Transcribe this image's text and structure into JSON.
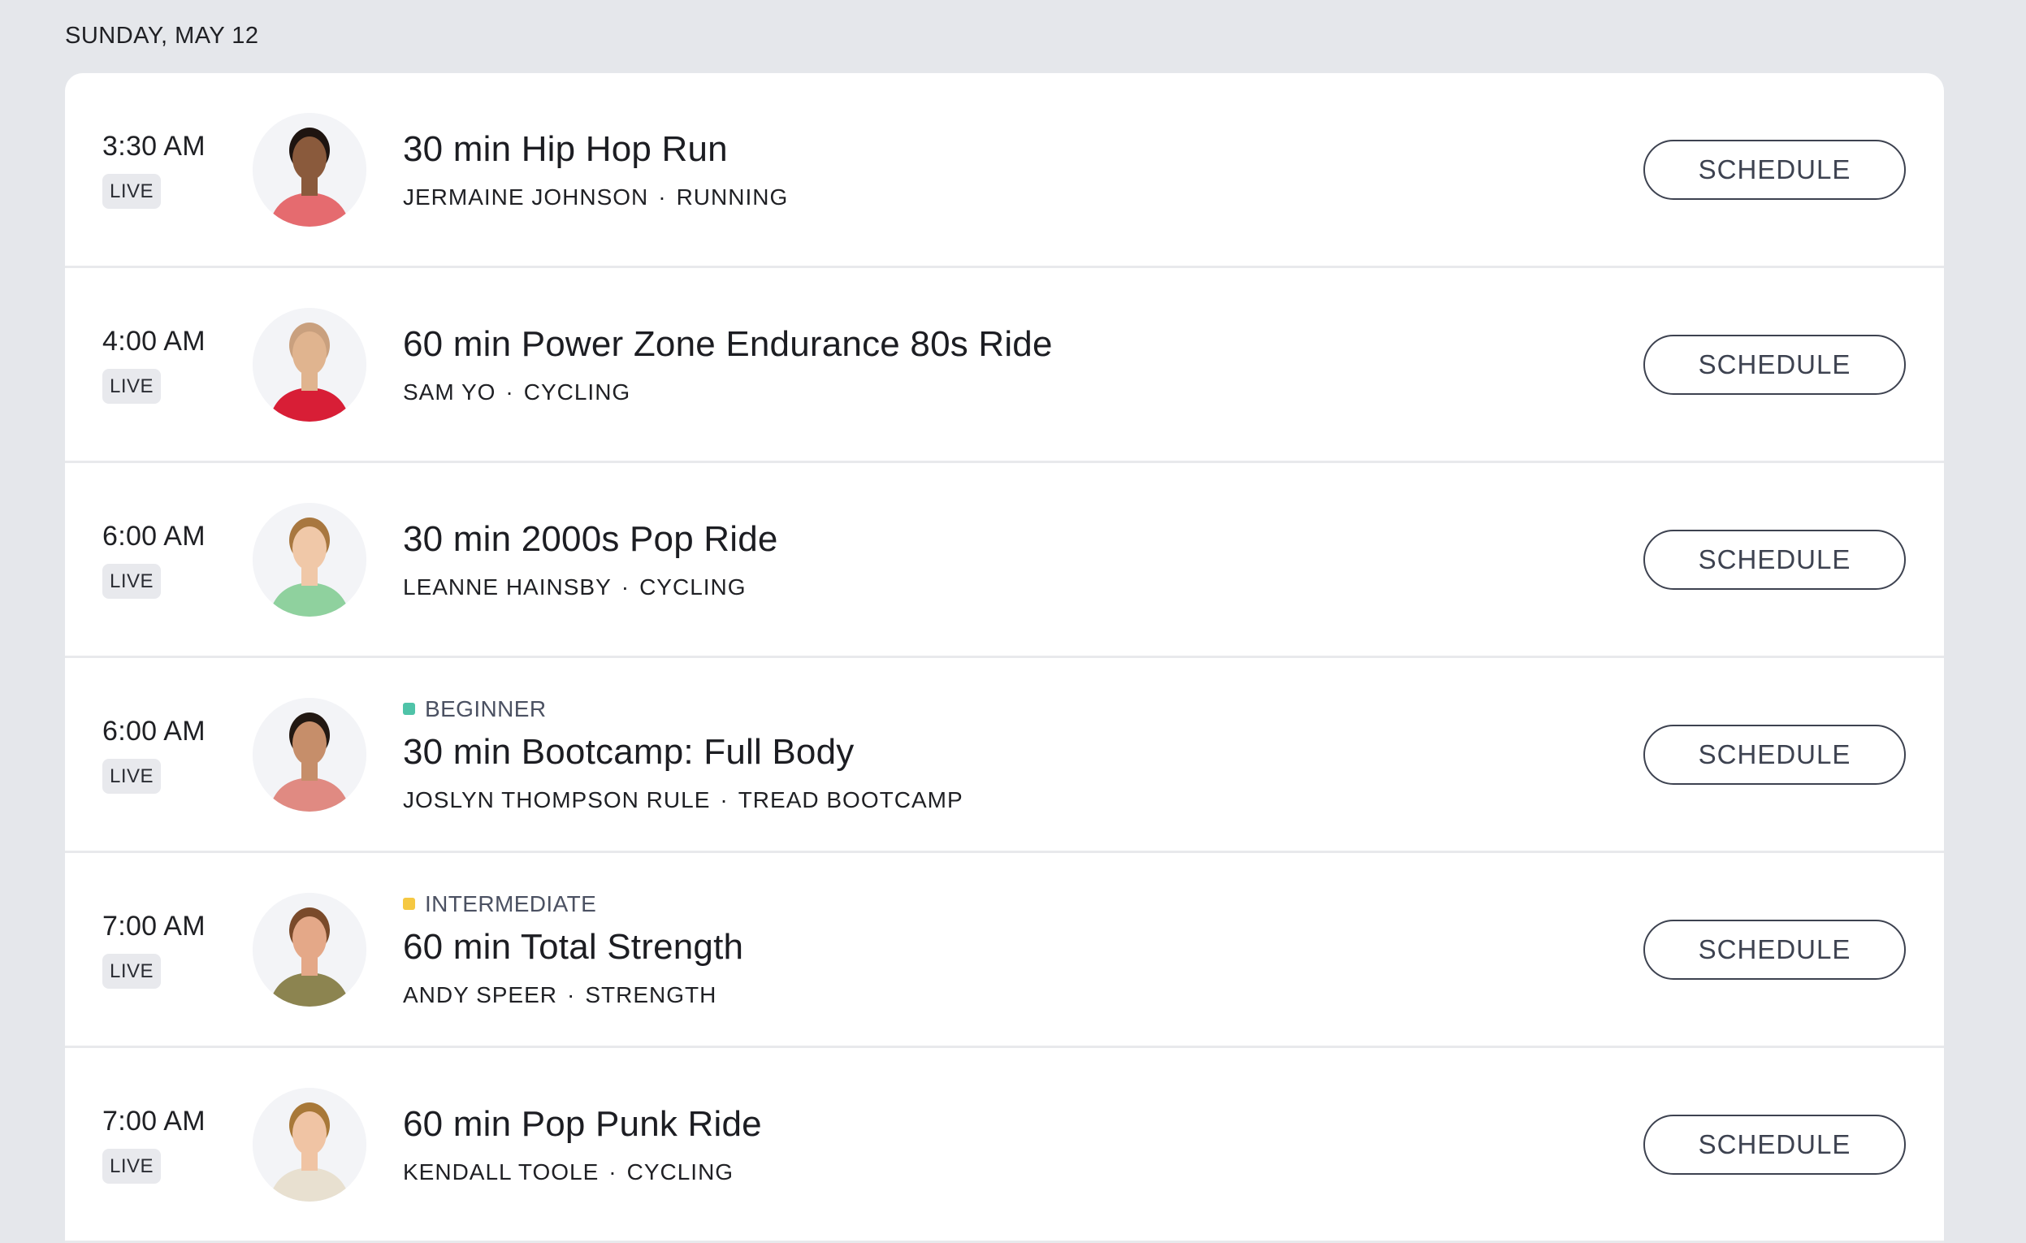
{
  "date_header": "SUNDAY, MAY 12",
  "separator": "·",
  "classes": [
    {
      "time": "3:30 AM",
      "badge": "LIVE",
      "difficulty": null,
      "title": "30 min Hip Hop Run",
      "instructor": "JERMAINE JOHNSON",
      "category": "RUNNING",
      "button": "SCHEDULE",
      "avatar": {
        "skin": "#8a5a3c",
        "hair": "#1e1410",
        "shirt": "#e56b6f"
      }
    },
    {
      "time": "4:00 AM",
      "badge": "LIVE",
      "difficulty": null,
      "title": "60 min Power Zone Endurance 80s Ride",
      "instructor": "SAM YO",
      "category": "CYCLING",
      "button": "SCHEDULE",
      "avatar": {
        "skin": "#e0b48f",
        "hair": "#c9a07e",
        "shirt": "#d81e36"
      }
    },
    {
      "time": "6:00 AM",
      "badge": "LIVE",
      "difficulty": null,
      "title": "30 min 2000s Pop Ride",
      "instructor": "LEANNE HAINSBY",
      "category": "CYCLING",
      "button": "SCHEDULE",
      "avatar": {
        "skin": "#f0c8a8",
        "hair": "#a8773f",
        "shirt": "#8fd19e"
      }
    },
    {
      "time": "6:00 AM",
      "badge": "LIVE",
      "difficulty": {
        "label": "BEGINNER",
        "color": "#4fc3a8"
      },
      "title": "30 min Bootcamp: Full Body",
      "instructor": "JOSLYN THOMPSON RULE",
      "category": "TREAD BOOTCAMP",
      "button": "SCHEDULE",
      "avatar": {
        "skin": "#c68e6a",
        "hair": "#221812",
        "shirt": "#e08a82"
      }
    },
    {
      "time": "7:00 AM",
      "badge": "LIVE",
      "difficulty": {
        "label": "INTERMEDIATE",
        "color": "#f5c842"
      },
      "title": "60 min Total Strength",
      "instructor": "ANDY SPEER",
      "category": "STRENGTH",
      "button": "SCHEDULE",
      "avatar": {
        "skin": "#e4a888",
        "hair": "#7a4a2a",
        "shirt": "#8c8450"
      }
    },
    {
      "time": "7:00 AM",
      "badge": "LIVE",
      "difficulty": null,
      "title": "60 min Pop Punk Ride",
      "instructor": "KENDALL TOOLE",
      "category": "CYCLING",
      "button": "SCHEDULE",
      "avatar": {
        "skin": "#f0c4a4",
        "hair": "#a87838",
        "shirt": "#e8e0d0"
      }
    }
  ]
}
